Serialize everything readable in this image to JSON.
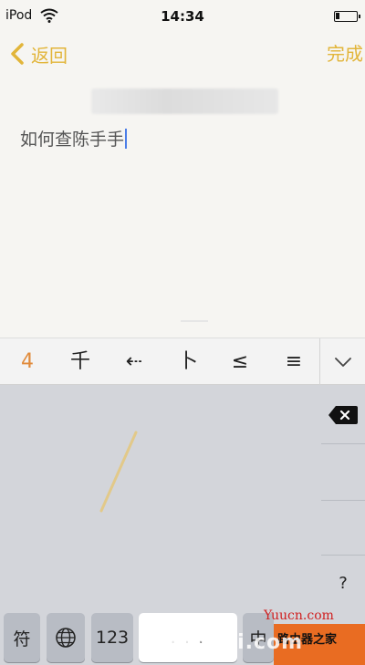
{
  "status_bar": {
    "device": "iPod",
    "time": "14:34",
    "battery_level": 0.2
  },
  "nav": {
    "back_label": "返回",
    "done_label": "完成",
    "accent_color": "#e2b53a"
  },
  "note": {
    "text": "如何查陈手手"
  },
  "candidates": [
    "4",
    "千",
    "⇠",
    "卜",
    "≤",
    "≡"
  ],
  "keyboard": {
    "delete_icon": "delete-backspace-icon",
    "question_label": "?",
    "symbols_label": "符",
    "globe_icon": "globe-icon",
    "numbers_label": "123",
    "space_label": "· · ·",
    "chinese_label": "中"
  },
  "watermark": {
    "url": "Yuucn.com",
    "box_text": "路由器之家",
    "overlay_text": "luyouqi.com"
  }
}
